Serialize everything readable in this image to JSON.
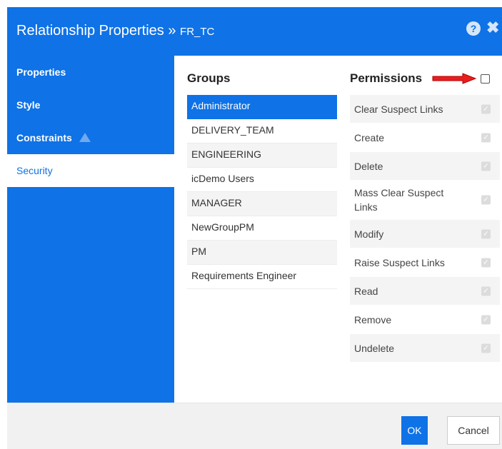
{
  "header": {
    "title": "Relationship Properties",
    "separator": "»",
    "subtitle": "FR_TC",
    "help_icon": "question-circle-icon",
    "help_glyph": "?",
    "close_icon": "close-icon",
    "close_glyph": "✖",
    "accent_color": "#0f72e6"
  },
  "sidebar": {
    "items": [
      {
        "label": "Properties",
        "active": false
      },
      {
        "label": "Style",
        "active": false
      },
      {
        "label": "Constraints",
        "active": false,
        "icon": "warning-triangle-icon"
      },
      {
        "label": "Security",
        "active": true
      }
    ]
  },
  "groups": {
    "heading": "Groups",
    "items": [
      {
        "label": "Administrator",
        "selected": true
      },
      {
        "label": "DELIVERY_TEAM",
        "selected": false
      },
      {
        "label": "ENGINEERING",
        "selected": false
      },
      {
        "label": "icDemo Users",
        "selected": false
      },
      {
        "label": "MANAGER",
        "selected": false
      },
      {
        "label": "NewGroupPM",
        "selected": false
      },
      {
        "label": "PM",
        "selected": false
      },
      {
        "label": "Requirements Engineer",
        "selected": false
      }
    ]
  },
  "permissions": {
    "heading": "Permissions",
    "select_all_checked": false,
    "annotation": "red-arrow-icon",
    "items": [
      {
        "label": "Clear Suspect Links",
        "checked": true
      },
      {
        "label": "Create",
        "checked": true
      },
      {
        "label": "Delete",
        "checked": true
      },
      {
        "label": "Mass Clear Suspect Links",
        "checked": true
      },
      {
        "label": "Modify",
        "checked": true
      },
      {
        "label": "Raise Suspect Links",
        "checked": true
      },
      {
        "label": "Read",
        "checked": true
      },
      {
        "label": "Remove",
        "checked": true
      },
      {
        "label": "Undelete",
        "checked": true
      }
    ],
    "check_glyph": "✓"
  },
  "footer": {
    "ok_label": "OK",
    "cancel_label": "Cancel"
  }
}
